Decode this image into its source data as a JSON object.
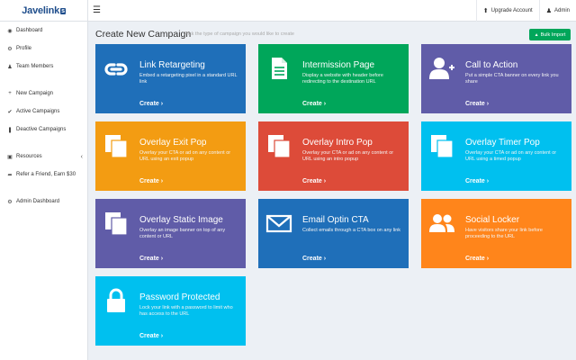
{
  "header": {
    "logo_text": "Javelink",
    "logo_badge": "s",
    "menu_icon": "hamburger-icon",
    "upgrade_label": "Upgrade Account",
    "admin_label": "Admin"
  },
  "sidebar": {
    "items": [
      {
        "label": "Dashboard",
        "icon": "dashboard-icon"
      },
      {
        "label": "Profile",
        "icon": "gear-icon"
      },
      {
        "label": "Team Members",
        "icon": "user-icon"
      },
      {
        "label": "New Campaign",
        "icon": "plus-icon"
      },
      {
        "label": "Active Campaigns",
        "icon": "check-icon"
      },
      {
        "label": "Deactive Campaigns",
        "icon": "pause-icon"
      },
      {
        "label": "Resources",
        "icon": "folder-icon"
      },
      {
        "label": "Refer a Friend, Earn $30",
        "icon": "share-icon"
      },
      {
        "label": "Admin Dashboard",
        "icon": "settings-icon"
      }
    ]
  },
  "main": {
    "title": "Create New Campaign",
    "subtitle": "Pick the type of campaign you would like to create",
    "bulk_import": "Bulk Import"
  },
  "cards": [
    {
      "title": "Link Retargeting",
      "desc": "Embed a retargeting pixel in a standard URL link",
      "create": "Create",
      "color": "#1f6fb9",
      "icon": "chain-link-icon"
    },
    {
      "title": "Intermission Page",
      "desc": "Display a website with header before redirecting to the destination URL",
      "create": "Create",
      "color": "#00a65a",
      "icon": "document-icon"
    },
    {
      "title": "Call to Action",
      "desc": "Put a simple CTA banner on every link you share",
      "create": "Create",
      "color": "#605ca8",
      "icon": "add-user-icon"
    },
    {
      "title": "Overlay Exit Pop",
      "desc": "Overlay your CTA or ad on any content or URL using an exit popup",
      "create": "Create",
      "color": "#f39c12",
      "icon": "copy-icon"
    },
    {
      "title": "Overlay Intro Pop",
      "desc": "Overlay your CTA or ad on any content or URL using an intro popup",
      "create": "Create",
      "color": "#dd4b39",
      "icon": "copy-icon"
    },
    {
      "title": "Overlay Timer Pop",
      "desc": "Overlay your CTA or ad on any content or URL using a timed popup",
      "create": "Create",
      "color": "#00c0ef",
      "icon": "copy-icon"
    },
    {
      "title": "Overlay Static Image",
      "desc": "Overlay an image banner on top of any content or URL",
      "create": "Create",
      "color": "#605ca8",
      "icon": "copy-icon"
    },
    {
      "title": "Email Optin CTA",
      "desc": "Collect emails through a CTA box on any link",
      "create": "Create",
      "color": "#1f6fb9",
      "icon": "envelope-icon"
    },
    {
      "title": "Social Locker",
      "desc": "Have visitors share your link before proceeding to the URL",
      "create": "Create",
      "color": "#ff851b",
      "icon": "users-icon"
    },
    {
      "title": "Password Protected",
      "desc": "Lock your link with a password to limit who has access to the URL",
      "create": "Create",
      "color": "#00c0ef",
      "icon": "lock-icon"
    }
  ]
}
